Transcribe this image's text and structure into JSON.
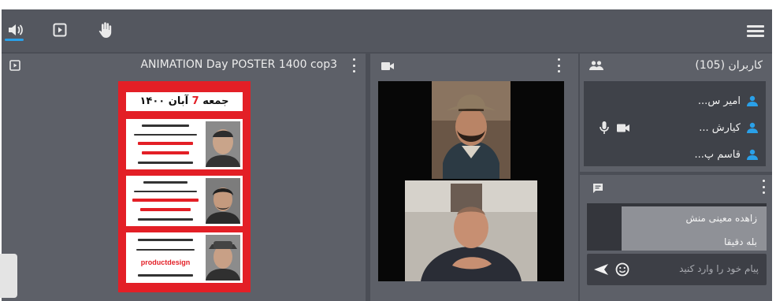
{
  "toolbar": {
    "icons": [
      "speaker-icon",
      "play-box-icon",
      "hand-icon",
      "menu-icon"
    ],
    "accent": "#2aa0e8"
  },
  "presentation": {
    "title": "ANIMATION Day POSTER 1400 cop3",
    "poster": {
      "date_part1": "جمعه",
      "date_num": "7",
      "date_part2": "آبان ۱۴۰۰",
      "slots": [
        {
          "heading": ""
        },
        {
          "heading": ""
        },
        {
          "heading": "productdesign"
        }
      ],
      "bg_color": "#e31f26"
    }
  },
  "video": {
    "icon": "camera-icon"
  },
  "users": {
    "title": "کاربران (105)",
    "items": [
      {
        "name": "امیر س..."
      },
      {
        "name": "کیارش ..."
      },
      {
        "name": "قاسم پ..."
      }
    ]
  },
  "chat": {
    "sender": "زاهده معینی منش",
    "message": "بله دقیقا",
    "placeholder": "پیام خود را وارد کنید"
  }
}
